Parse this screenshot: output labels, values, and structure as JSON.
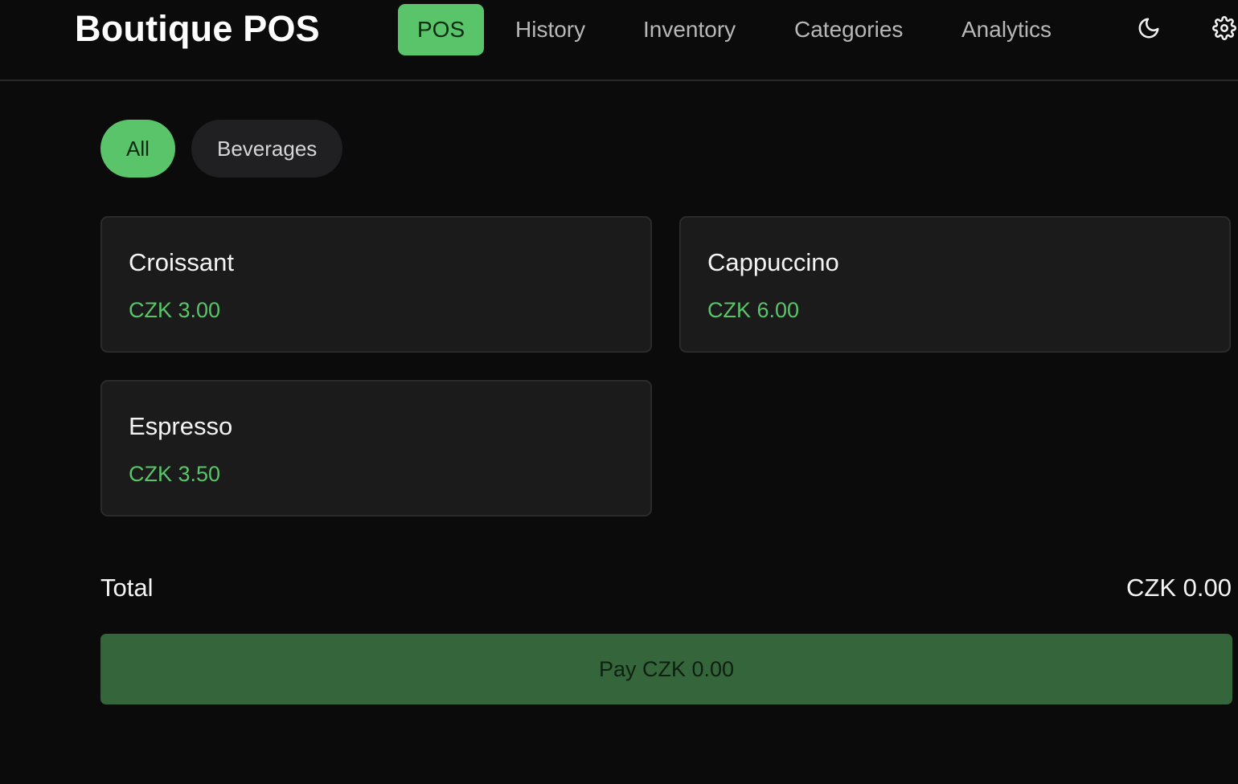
{
  "app": {
    "title": "Boutique POS"
  },
  "nav": {
    "tabs": [
      {
        "label": "POS",
        "active": true
      },
      {
        "label": "History",
        "active": false
      },
      {
        "label": "Inventory",
        "active": false
      },
      {
        "label": "Categories",
        "active": false
      },
      {
        "label": "Analytics",
        "active": false
      }
    ],
    "icons": [
      "moon-icon",
      "gear-icon"
    ]
  },
  "categories": [
    {
      "label": "All",
      "active": true
    },
    {
      "label": "Beverages",
      "active": false
    }
  ],
  "products": [
    {
      "name": "Croissant",
      "price": "CZK 3.00"
    },
    {
      "name": "Cappuccino",
      "price": "CZK 6.00"
    },
    {
      "name": "Espresso",
      "price": "CZK 3.50"
    }
  ],
  "cart": {
    "total_label": "Total",
    "total_value": "CZK 0.00",
    "pay_label": "Pay CZK 0.00"
  },
  "colors": {
    "accent": "#5ac46a",
    "background": "#0b0b0b",
    "card": "#1b1b1b",
    "pay_button": "#35653a"
  }
}
